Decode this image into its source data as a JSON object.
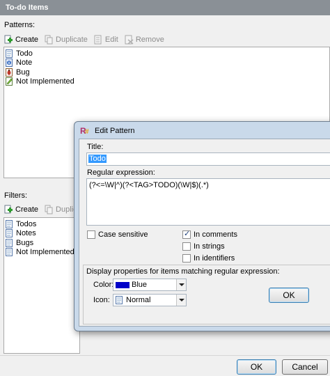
{
  "window_title": "To-do Items",
  "patterns": {
    "label": "Patterns:",
    "toolbar": {
      "create": "Create",
      "duplicate": "Duplicate",
      "edit": "Edit",
      "remove": "Remove"
    },
    "items": [
      {
        "label": "Todo",
        "icon": "todo-icon"
      },
      {
        "label": "Note",
        "icon": "note-icon"
      },
      {
        "label": "Bug",
        "icon": "bug-icon"
      },
      {
        "label": "Not Implemented",
        "icon": "not-implemented-icon"
      }
    ]
  },
  "filters": {
    "label": "Filters:",
    "toolbar": {
      "create": "Create",
      "duplicate": "Duplica"
    },
    "items": [
      {
        "label": "Todos",
        "icon": "filter-icon"
      },
      {
        "label": "Notes",
        "icon": "filter-icon"
      },
      {
        "label": "Bugs",
        "icon": "filter-icon"
      },
      {
        "label": "Not Implemented",
        "icon": "filter-icon"
      }
    ]
  },
  "dialog": {
    "title": "Edit Pattern",
    "title_label": "Title:",
    "title_value": "Todo",
    "regex_label": "Regular expression:",
    "regex_value": "(?<=\\W|^)(?<TAG>TODO)(\\W|$)(.*)",
    "case_sensitive": {
      "label": "Case sensitive",
      "checked": false
    },
    "in_comments": {
      "label": "In comments",
      "checked": true
    },
    "in_strings": {
      "label": "In strings",
      "checked": false
    },
    "in_identifiers": {
      "label": "In identifiers",
      "checked": false
    },
    "display_props_label": "Display properties for items matching regular expression:",
    "color_label": "Color:",
    "color_value": "Blue",
    "color_hex": "#0000c8",
    "icon_label": "Icon:",
    "icon_value": "Normal",
    "ok_label": "OK"
  },
  "footer": {
    "ok_label": "OK",
    "cancel_label": "Cancel"
  }
}
